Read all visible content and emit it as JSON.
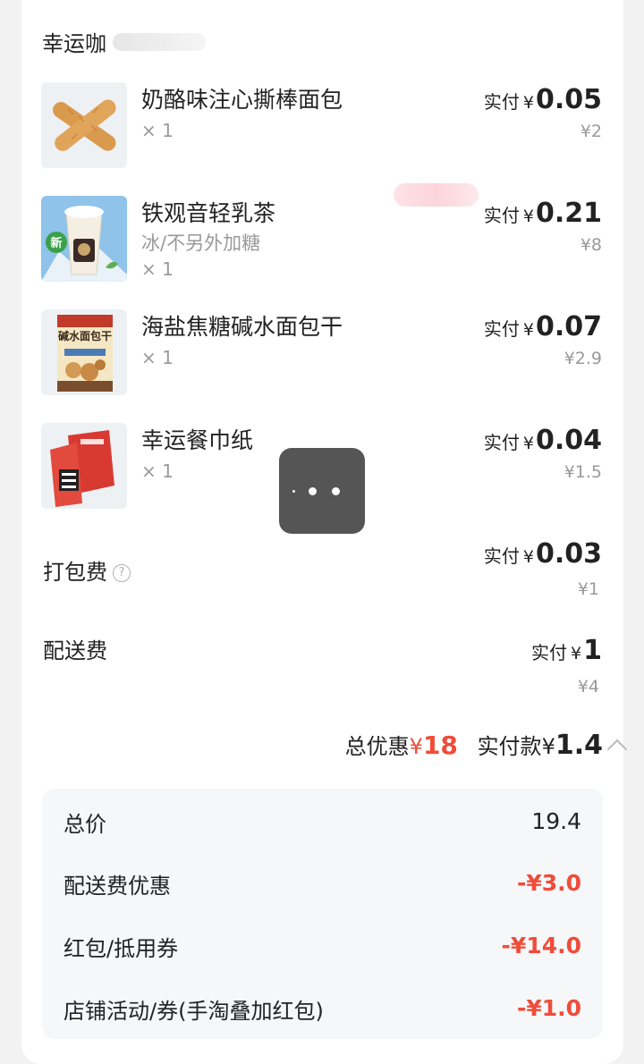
{
  "store": {
    "name": "幸运咖"
  },
  "items": [
    {
      "name": "奶酪味注心撕棒面包",
      "spec": "",
      "qty": "× 1",
      "paid_label": "实付",
      "currency": "¥",
      "paid": "0.05",
      "original": "¥2",
      "thumb_icon": "cheese-bread-image"
    },
    {
      "name": "铁观音轻乳茶",
      "spec": "冰/不另外加糖",
      "qty": "× 1",
      "paid_label": "实付",
      "currency": "¥",
      "paid": "0.21",
      "original": "¥8",
      "thumb_icon": "milk-tea-image",
      "badge": "新"
    },
    {
      "name": "海盐焦糖碱水面包干",
      "spec": "",
      "qty": "× 1",
      "paid_label": "实付",
      "currency": "¥",
      "paid": "0.07",
      "original": "¥2.9",
      "thumb_icon": "bread-snack-bag-image",
      "pack_text": "碱水面包干"
    },
    {
      "name": "幸运餐巾纸",
      "spec": "",
      "qty": "× 1",
      "paid_label": "实付",
      "currency": "¥",
      "paid": "0.04",
      "original": "¥1.5",
      "thumb_icon": "napkin-box-image"
    }
  ],
  "fees": [
    {
      "label": "打包费",
      "help_icon": "question-circle-icon",
      "help_glyph": "?",
      "paid_label": "实付",
      "currency": "¥",
      "paid": "0.03",
      "original": "¥1"
    },
    {
      "label": "配送费",
      "paid_label": "实付",
      "currency": "¥",
      "paid": "1",
      "original": "¥4"
    }
  ],
  "summary": {
    "discount_label": "总优惠",
    "discount_currency": "¥",
    "discount_amount": "18",
    "total_label": "实付款",
    "total_currency": "¥",
    "total_amount": "1.4",
    "toggle_icon": "chevron-up-icon"
  },
  "breakdown": [
    {
      "label": "总价",
      "value": "19.4",
      "red": false
    },
    {
      "label": "配送费优惠",
      "value": "-¥3.0",
      "red": true
    },
    {
      "label": "红包/抵用券",
      "value": "-¥14.0",
      "red": true
    },
    {
      "label": "店铺活动/券(手淘叠加红包)",
      "value": "-¥1.0",
      "red": true
    }
  ],
  "floating_button": {
    "icon": "more-dots-icon"
  },
  "colors": {
    "accent_red": "#f04c3a",
    "text": "#222222",
    "muted": "#9a9a9a",
    "panel_bg": "#f6f7f9"
  }
}
